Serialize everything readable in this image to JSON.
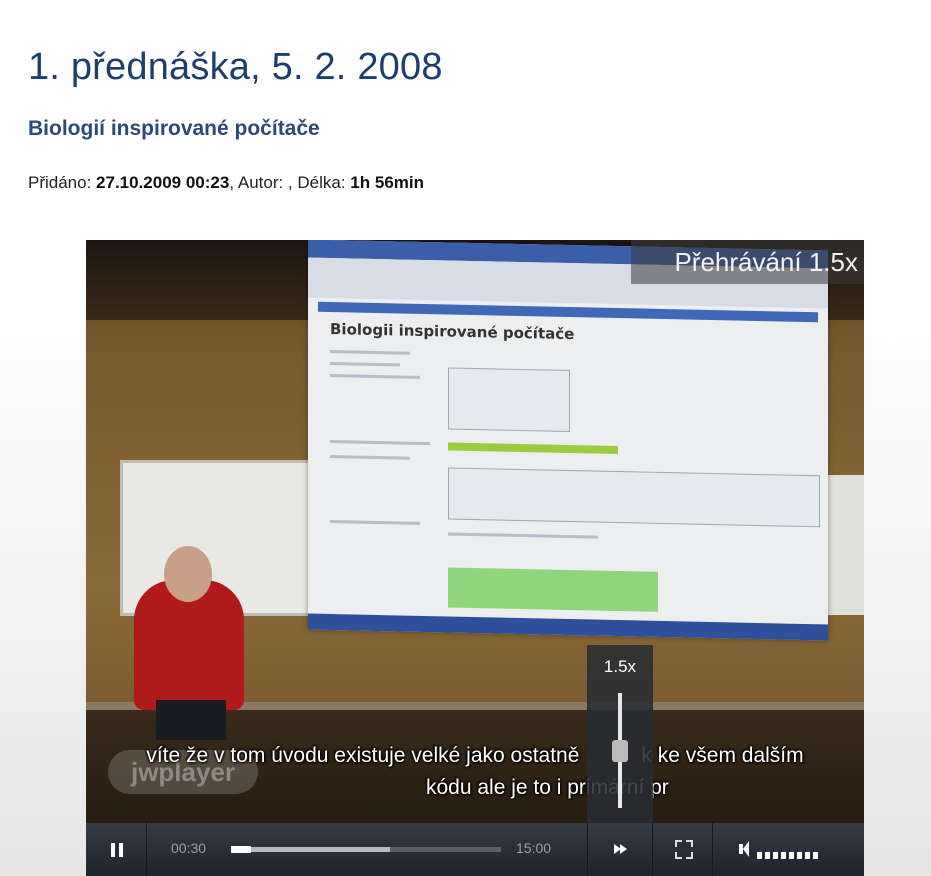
{
  "page": {
    "title": "1. přednáška, 5. 2. 2008",
    "subtitle": "Biologií inspirované počítače",
    "meta": {
      "added_label": "Přidáno: ",
      "added_value": "27.10.2009 00:23",
      "author_label": ", Autor: , Délka: ",
      "length_value": "1h 56min"
    }
  },
  "player": {
    "speed_badge": "Přehrávání 1.5x",
    "watermark": "jwplayer",
    "subtitle_line1": "víte že v tom úvodu existuje velké jako ostatně",
    "subtitle_line1b": "k ke všem dalším",
    "subtitle_line2": "kódu ale je to i primární pr",
    "speed_popup_label": "1.5x",
    "screen_heading": "Biologii inspirované počítače",
    "controls": {
      "current_time": "00:30",
      "duration": "15:00",
      "progress_fraction": 0.033,
      "buffered_fraction": 0.59,
      "volume_level": 8
    }
  }
}
